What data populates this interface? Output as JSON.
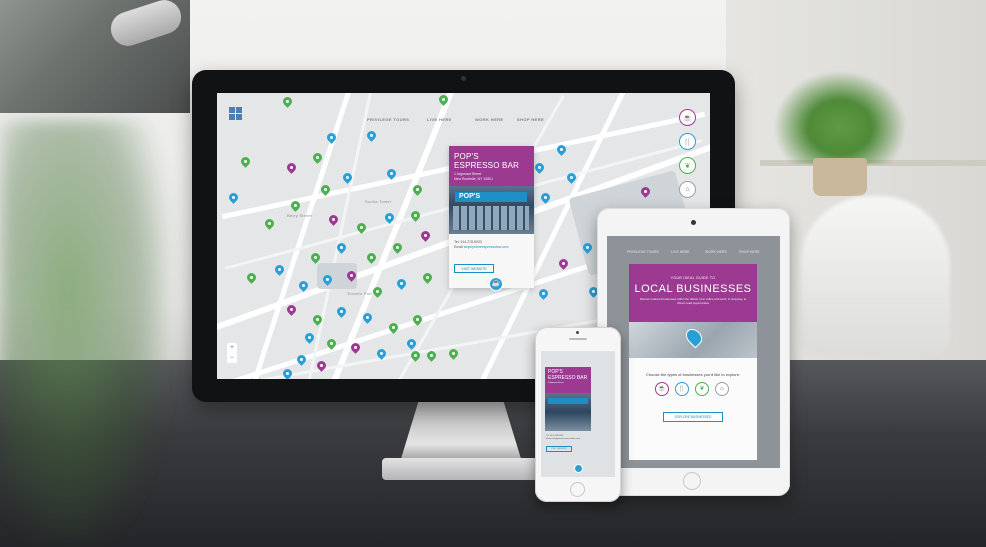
{
  "colors": {
    "purple": "#9c3a92",
    "blue": "#2a9fd6",
    "green": "#4caf50",
    "accent": "#1e8fc4"
  },
  "map": {
    "topnav": [
      "PRIVILEGE TOURS",
      "LIVE HERE",
      "WORK HERE",
      "SHOP HERE"
    ],
    "labels": [
      "Scotia Tower",
      "Toronto Pub",
      "Berry Street"
    ],
    "zoom": {
      "in": "+",
      "out": "−"
    },
    "category_icons": [
      "coffee-cup-icon",
      "cutlery-icon",
      "leaf-icon",
      "hanger-icon"
    ]
  },
  "popup": {
    "title_line1": "POP'S",
    "title_line2": "ESPRESSO BAR",
    "address_line1": "1 Argonaut Street",
    "address_line2": "New Rochelle, NY 10801",
    "sign_text": "POP'S",
    "phone": "Tel. 914.278.5033",
    "email_label": "Email",
    "email": "stopbystoreespressobar.com",
    "button": "VISIT WEBSITE"
  },
  "ipad": {
    "nav": [
      "PRIVILEGE TOURS",
      "LIVE HERE",
      "WORK HERE",
      "SHOP HERE"
    ],
    "kicker": "YOUR IDEAL GUIDE TO",
    "headline": "LOCAL BUSINESSES",
    "description": "Discover featured businesses within the district, from coffee and lunch, to shopping, to vibrant retail opportunities",
    "choose": "Choose the types of businesses you'd like to explore:",
    "explore_button": "EXPLORE BUSINESSES"
  },
  "iphone": {
    "title_line1": "POP'S",
    "title_line2": "ESPRESSO BAR",
    "address": "1 Argonaut Street",
    "phone": "Tel. 914.278.5033",
    "email": "Email  stopbystoreespressobar.com",
    "button": "VISIT WEBSITE"
  }
}
